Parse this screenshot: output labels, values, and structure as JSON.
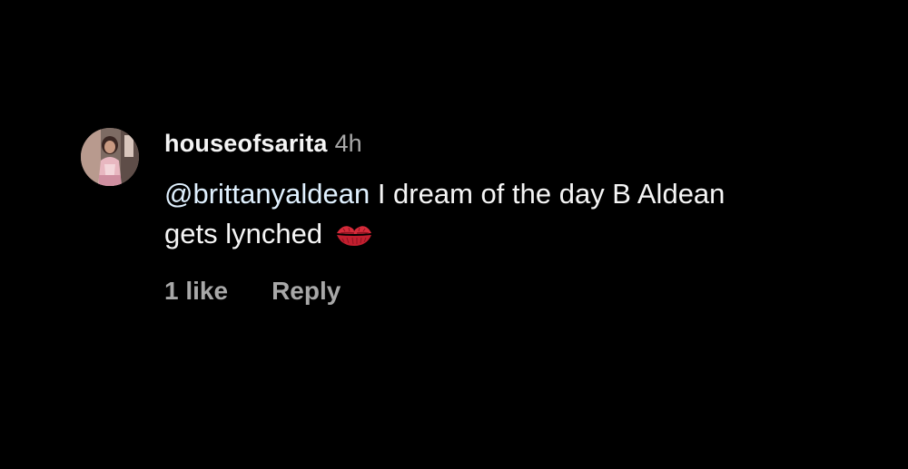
{
  "comment": {
    "username": "houseofsarita",
    "timestamp": "4h",
    "mention": "@brittanyaldean",
    "text_line1": " I dream of the day B Aldean",
    "text_line2": "gets lynched",
    "emoji_icon": "kiss-mark-icon",
    "likes_label": "1 like",
    "reply_label": "Reply"
  },
  "colors": {
    "background": "#000000",
    "primary_text": "#f5f5f5",
    "secondary_text": "#a8a8a8",
    "mention": "#e0f1ff",
    "emoji": "#d62b3a"
  }
}
